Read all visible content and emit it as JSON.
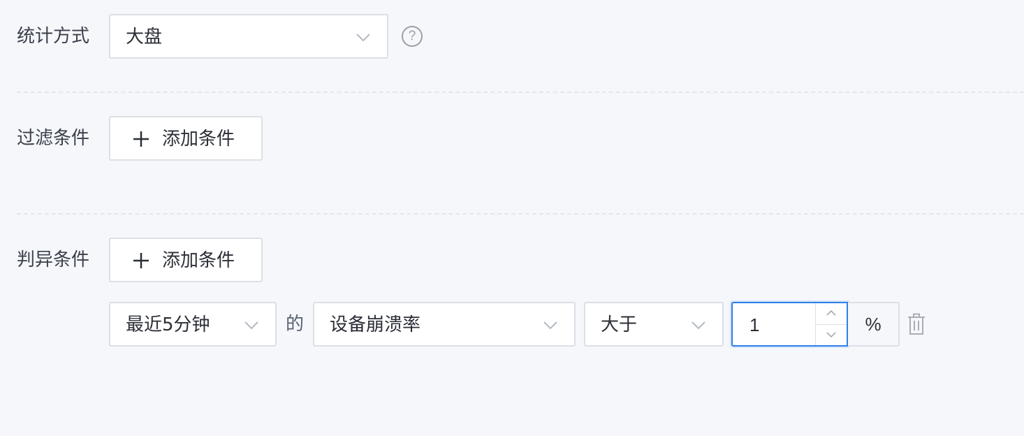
{
  "stat_method": {
    "label": "统计方式",
    "value": "大盘",
    "help_icon": "question-circle-icon",
    "help_glyph": "?"
  },
  "filter_conditions": {
    "label": "过滤条件",
    "add_button_label": "添加条件",
    "add_icon": "plus-icon"
  },
  "anomaly_conditions": {
    "label": "判异条件",
    "add_button_label": "添加条件",
    "add_icon": "plus-icon",
    "rule": {
      "time_window": "最近5分钟",
      "connector": "的",
      "metric": "设备崩溃率",
      "operator": "大于",
      "threshold": "1",
      "unit": "%",
      "delete_icon": "trash-icon"
    }
  },
  "colors": {
    "background": "#f5f7fb",
    "border": "#dcdfe6",
    "focus_border": "#2f80ed",
    "text": "#2b2f36",
    "muted_icon": "#9aa0aa"
  }
}
